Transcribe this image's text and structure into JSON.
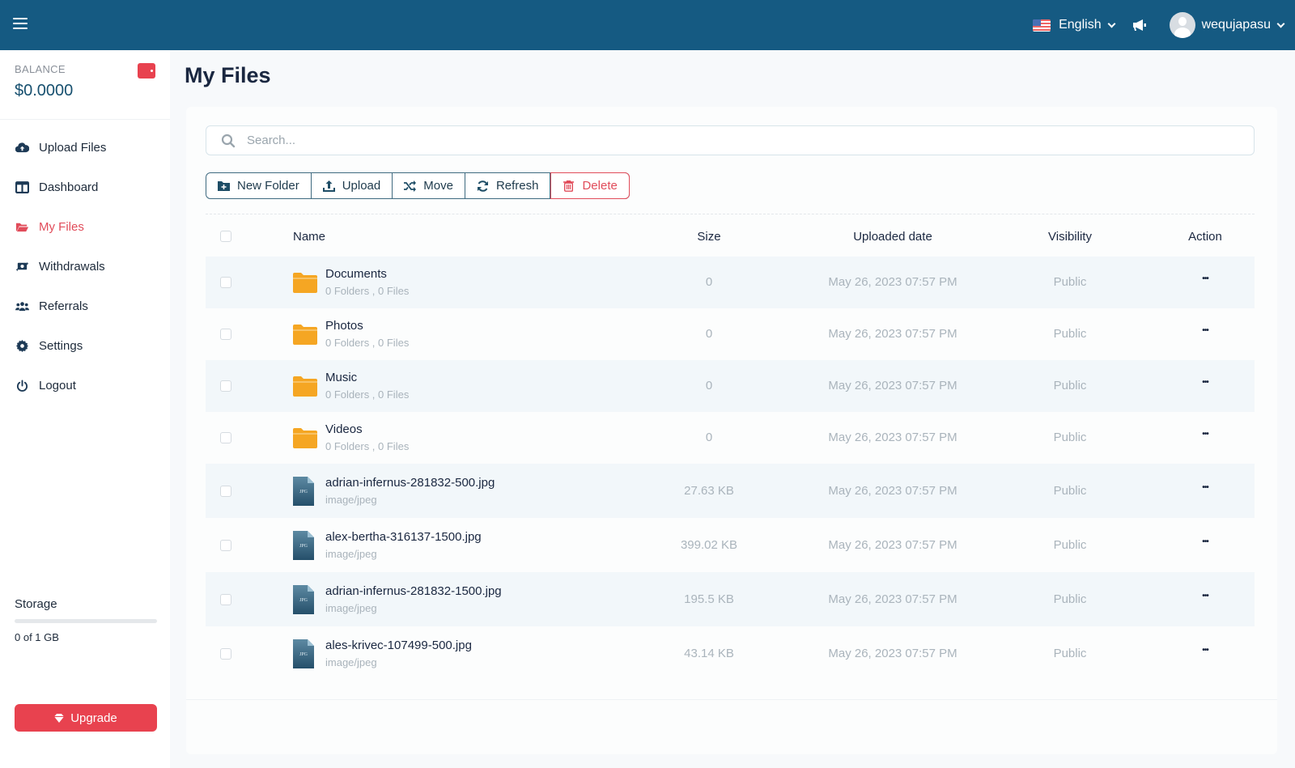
{
  "header": {
    "menu_icon": "hamburger-icon",
    "language": "English",
    "language_flag": "us-flag-icon",
    "announcement_icon": "megaphone-icon",
    "username": "wequjapasu",
    "brand_color": "#155a82"
  },
  "sidebar": {
    "balance_label": "BALANCE",
    "balance_value": "$0.0000",
    "wallet_icon": "wallet-icon",
    "items": [
      {
        "label": "Upload Files",
        "icon": "cloud-upload-icon",
        "active": false
      },
      {
        "label": "Dashboard",
        "icon": "dashboard-icon",
        "active": false
      },
      {
        "label": "My Files",
        "icon": "folder-open-icon",
        "active": true
      },
      {
        "label": "Withdrawals",
        "icon": "money-exchange-icon",
        "active": false
      },
      {
        "label": "Referrals",
        "icon": "users-icon",
        "active": false
      },
      {
        "label": "Settings",
        "icon": "gear-icon",
        "active": false
      },
      {
        "label": "Logout",
        "icon": "power-icon",
        "active": false
      }
    ],
    "storage": {
      "title": "Storage",
      "used_fraction": 0,
      "text": "0 of 1 GB"
    },
    "upgrade_label": "Upgrade",
    "accent_color": "#e8424f"
  },
  "main": {
    "title": "My Files",
    "search_placeholder": "Search...",
    "search_value": "",
    "toolbar": {
      "new_folder": "New Folder",
      "upload": "Upload",
      "move": "Move",
      "refresh": "Refresh",
      "delete": "Delete"
    },
    "table": {
      "columns": [
        "Name",
        "Size",
        "Uploaded date",
        "Visibility",
        "Action"
      ],
      "rows": [
        {
          "type": "folder",
          "name": "Documents",
          "sub": "0 Folders , 0 Files",
          "size": "0",
          "date": "May 26, 2023 07:57 PM",
          "visibility": "Public",
          "action": "•••"
        },
        {
          "type": "folder",
          "name": "Photos",
          "sub": "0 Folders , 0 Files",
          "size": "0",
          "date": "May 26, 2023 07:57 PM",
          "visibility": "Public",
          "action": "•••"
        },
        {
          "type": "folder",
          "name": "Music",
          "sub": "0 Folders , 0 Files",
          "size": "0",
          "date": "May 26, 2023 07:57 PM",
          "visibility": "Public",
          "action": "•••"
        },
        {
          "type": "folder",
          "name": "Videos",
          "sub": "0 Folders , 0 Files",
          "size": "0",
          "date": "May 26, 2023 07:57 PM",
          "visibility": "Public",
          "action": "•••"
        },
        {
          "type": "file",
          "name": "adrian-infernus-281832-500.jpg",
          "sub": "image/jpeg",
          "size": "27.63 KB",
          "date": "May 26, 2023 07:57 PM",
          "visibility": "Public",
          "action": "•••"
        },
        {
          "type": "file",
          "name": "alex-bertha-316137-1500.jpg",
          "sub": "image/jpeg",
          "size": "399.02 KB",
          "date": "May 26, 2023 07:57 PM",
          "visibility": "Public",
          "action": "•••"
        },
        {
          "type": "file",
          "name": "adrian-infernus-281832-1500.jpg",
          "sub": "image/jpeg",
          "size": "195.5 KB",
          "date": "May 26, 2023 07:57 PM",
          "visibility": "Public",
          "action": "•••"
        },
        {
          "type": "file",
          "name": "ales-krivec-107499-500.jpg",
          "sub": "image/jpeg",
          "size": "43.14 KB",
          "date": "May 26, 2023 07:57 PM",
          "visibility": "Public",
          "action": "•••"
        }
      ],
      "file_badge": "JPG"
    }
  }
}
